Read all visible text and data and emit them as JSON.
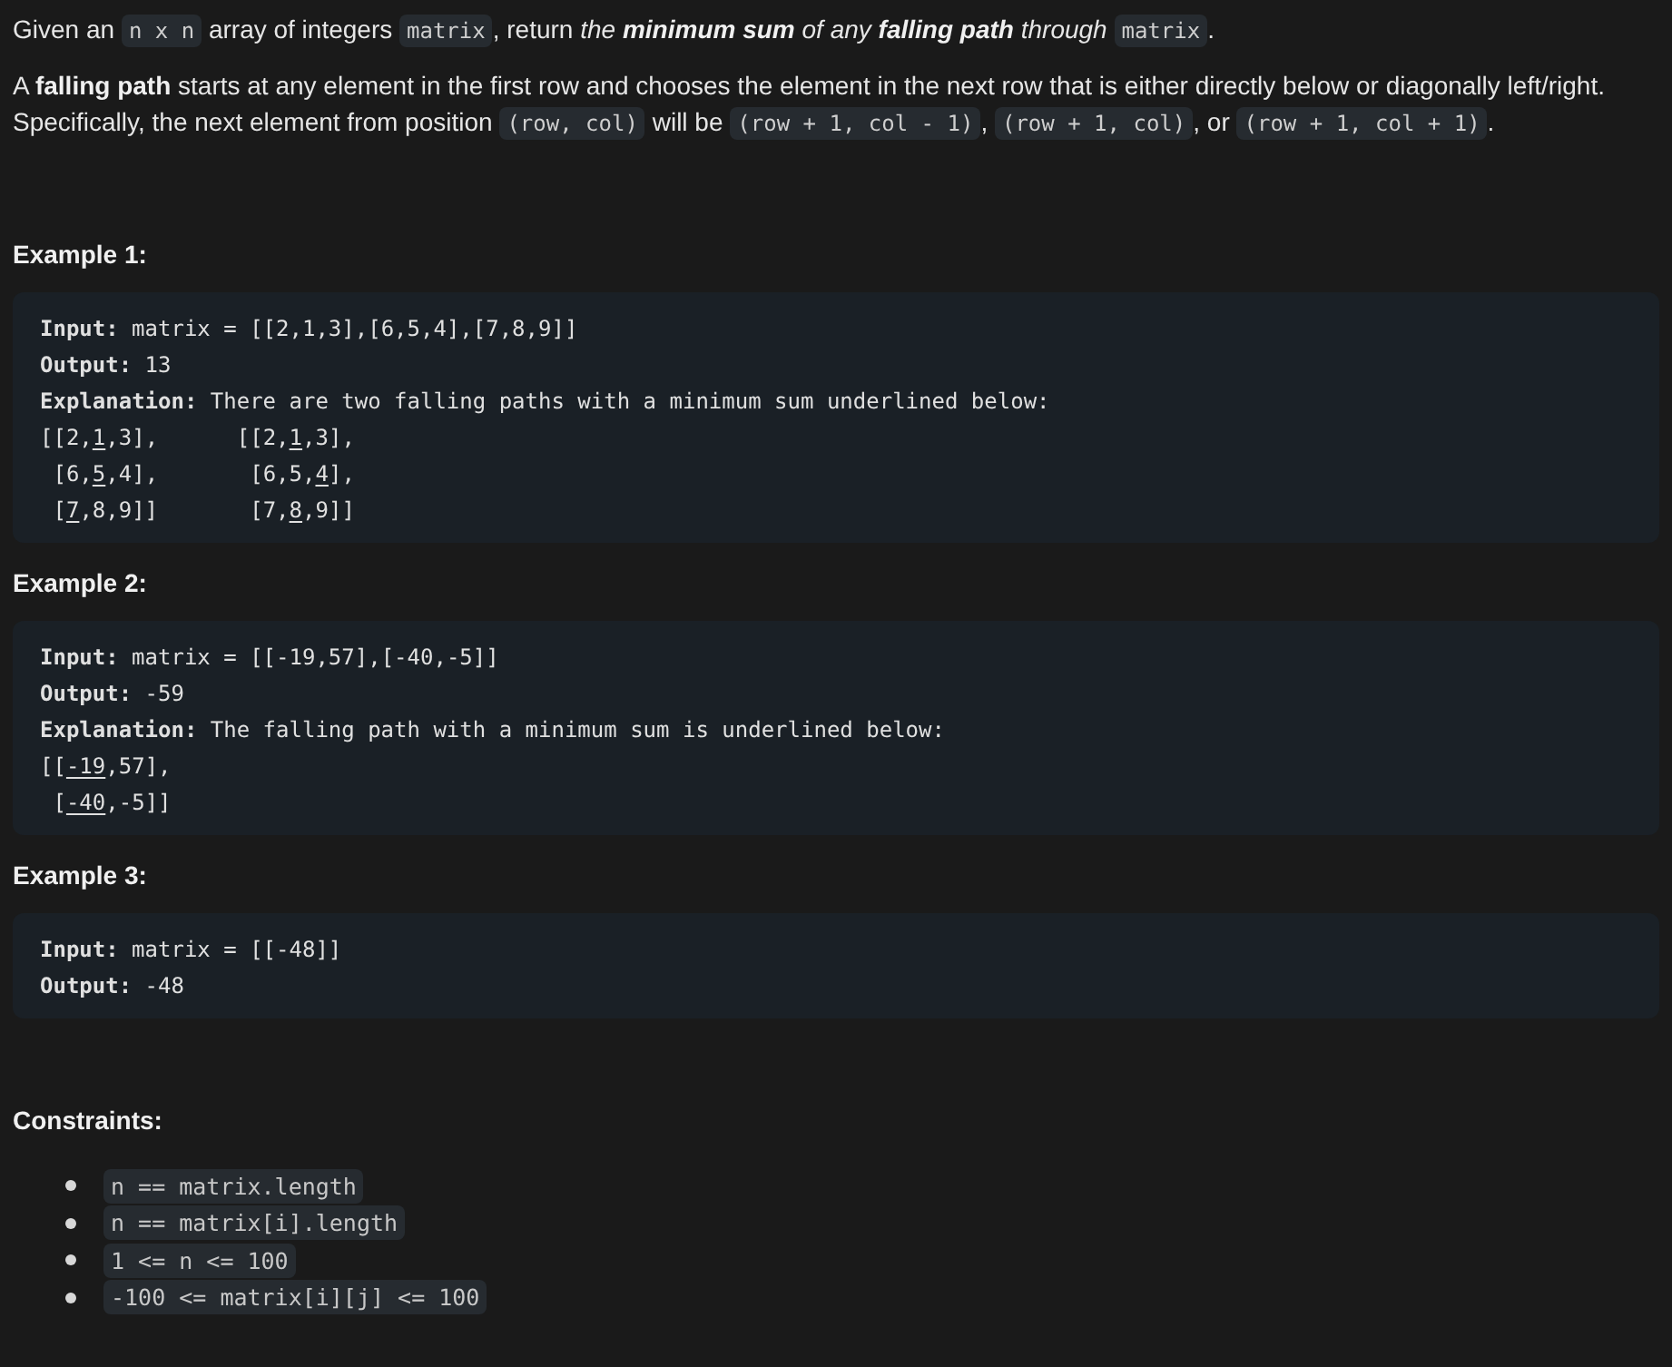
{
  "intro": [
    {
      "kind": "text",
      "text": "Given an "
    },
    {
      "kind": "code",
      "text": "n x n"
    },
    {
      "kind": "text",
      "text": " array of integers "
    },
    {
      "kind": "code",
      "text": "matrix"
    },
    {
      "kind": "text",
      "text": ", return "
    },
    {
      "kind": "em",
      "text": "the **minimum sum** of any **falling path** through "
    },
    {
      "kind": "code",
      "text": "matrix"
    },
    {
      "kind": "text",
      "text": "."
    }
  ],
  "definition": [
    {
      "kind": "text",
      "text": "A **falling path** starts at any element in the first row and chooses the element in the next row that is either directly below or diagonally left/right. Specifically, the next element from position "
    },
    {
      "kind": "code",
      "text": "(row, col)"
    },
    {
      "kind": "text",
      "text": " will be "
    },
    {
      "kind": "code",
      "text": "(row + 1, col - 1)"
    },
    {
      "kind": "text",
      "text": ", "
    },
    {
      "kind": "code",
      "text": "(row + 1, col)"
    },
    {
      "kind": "text",
      "text": ", or "
    },
    {
      "kind": "code",
      "text": "(row + 1, col + 1)"
    },
    {
      "kind": "text",
      "text": "."
    }
  ],
  "examples": [
    {
      "title": "Example 1:",
      "lines": [
        {
          "label": "Input:",
          "parts": [
            {
              "text": "matrix = [[2,1,3],[6,5,4],[7,8,9]]",
              "underlined": false
            }
          ]
        },
        {
          "label": "Output:",
          "parts": [
            {
              "text": "13",
              "underlined": false
            }
          ]
        },
        {
          "label": "Explanation:",
          "parts": [
            {
              "text": "There are two falling paths with a minimum sum underlined below:",
              "underlined": false
            }
          ]
        },
        {
          "parts": [
            {
              "text": "[[2,",
              "underlined": false
            },
            {
              "text": "1",
              "underlined": true
            },
            {
              "text": ",3],      [[2,",
              "underlined": false
            },
            {
              "text": "1",
              "underlined": true
            },
            {
              "text": ",3],",
              "underlined": false
            }
          ]
        },
        {
          "parts": [
            {
              "text": " [6,",
              "underlined": false
            },
            {
              "text": "5",
              "underlined": true
            },
            {
              "text": ",4],       [6,5,",
              "underlined": false
            },
            {
              "text": "4",
              "underlined": true
            },
            {
              "text": "],",
              "underlined": false
            }
          ]
        },
        {
          "parts": [
            {
              "text": " [",
              "underlined": false
            },
            {
              "text": "7",
              "underlined": true
            },
            {
              "text": ",8,9]]       [7,",
              "underlined": false
            },
            {
              "text": "8",
              "underlined": true
            },
            {
              "text": ",9]]",
              "underlined": false
            }
          ]
        }
      ]
    },
    {
      "title": "Example 2:",
      "lines": [
        {
          "label": "Input:",
          "parts": [
            {
              "text": "matrix = [[-19,57],[-40,-5]]",
              "underlined": false
            }
          ]
        },
        {
          "label": "Output:",
          "parts": [
            {
              "text": "-59",
              "underlined": false
            }
          ]
        },
        {
          "label": "Explanation:",
          "parts": [
            {
              "text": "The falling path with a minimum sum is underlined below:",
              "underlined": false
            }
          ]
        },
        {
          "parts": [
            {
              "text": "[[",
              "underlined": false
            },
            {
              "text": "-19",
              "underlined": true
            },
            {
              "text": ",57],",
              "underlined": false
            }
          ]
        },
        {
          "parts": [
            {
              "text": " [",
              "underlined": false
            },
            {
              "text": "-40",
              "underlined": true
            },
            {
              "text": ",-5]]",
              "underlined": false
            }
          ]
        }
      ]
    },
    {
      "title": "Example 3:",
      "lines": [
        {
          "label": "Input:",
          "parts": [
            {
              "text": "matrix = [[-48]]",
              "underlined": false
            }
          ]
        },
        {
          "label": "Output:",
          "parts": [
            {
              "text": "-48",
              "underlined": false
            }
          ]
        }
      ]
    }
  ],
  "constraints": {
    "title": "Constraints:",
    "items": [
      "n == matrix.length",
      "n == matrix[i].length",
      "1 <= n <= 100",
      "-100 <= matrix[i][j] <= 100"
    ]
  }
}
